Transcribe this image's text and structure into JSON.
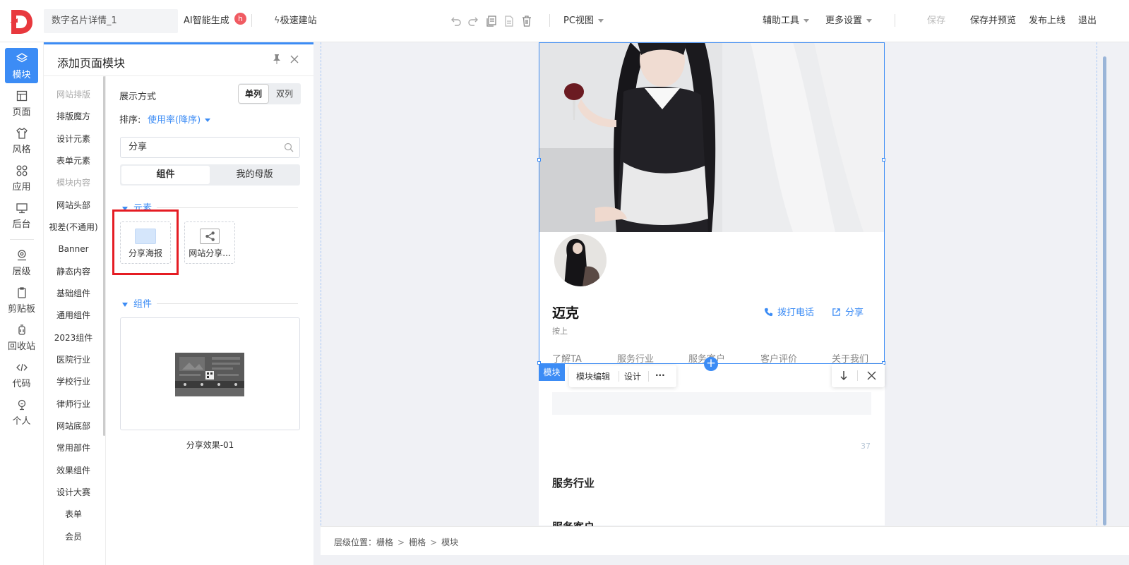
{
  "app": {
    "page_name": "数字名片详情_1",
    "ai_generate": "AI智能生成",
    "hot_badge": "h",
    "quick_build": "极速建站",
    "view_mode": "PC视图",
    "aux_tools": "辅助工具",
    "more_settings": "更多设置",
    "save": "保存",
    "save_preview": "保存并预览",
    "publish": "发布上线",
    "exit": "退出"
  },
  "rail": [
    {
      "label": "模块",
      "icon": "layers-icon"
    },
    {
      "label": "页面",
      "icon": "page-icon"
    },
    {
      "label": "风格",
      "icon": "shirt-icon"
    },
    {
      "label": "应用",
      "icon": "apps-icon"
    },
    {
      "label": "后台",
      "icon": "monitor-icon"
    },
    {
      "label": "层级",
      "icon": "location-icon"
    },
    {
      "label": "剪贴板",
      "icon": "clipboard-icon"
    },
    {
      "label": "回收站",
      "icon": "recycle-icon"
    },
    {
      "label": "代码",
      "icon": "code-icon"
    },
    {
      "label": "个人",
      "icon": "user-icon"
    }
  ],
  "panel": {
    "title": "添加页面模块",
    "categories": [
      "网站排版",
      "排版魔方",
      "设计元素",
      "表单元素",
      "模块内容",
      "网站头部",
      "视差(不通用)",
      "Banner",
      "静态内容",
      "基础组件",
      "通用组件",
      "2023组件",
      "医院行业",
      "学校行业",
      "律师行业",
      "网站底部",
      "常用部件",
      "效果组件",
      "设计大赛",
      "表单",
      "会员"
    ],
    "display_label": "展示方式",
    "single_col": "单列",
    "double_col": "双列",
    "sort_label": "排序:",
    "sort_value": "使用率(降序)",
    "search_value": "分享",
    "tab_components": "组件",
    "tab_master": "我的母版",
    "section_elements": "元素",
    "elements": [
      "分享海报",
      "网站分享..."
    ],
    "section_components": "组件",
    "component_card": "分享效果-01"
  },
  "canvas": {
    "name": "迈克",
    "subtitle": "按上",
    "call": "拨打电话",
    "share": "分享",
    "tabs": [
      "了解TA",
      "服务行业",
      "服务客户",
      "客户评价",
      "关于我们"
    ],
    "module_tag": "模块",
    "module_edit": "模块编辑",
    "design": "设计",
    "more": "···",
    "count": "37",
    "section1": "服务行业",
    "section2": "服务客户"
  },
  "breadcrumb": [
    "层级位置：栅格",
    "栅格",
    "模块"
  ],
  "colors": {
    "accent": "#3c8cf5",
    "badge": "#f05b62",
    "highlight": "#e51c23"
  }
}
